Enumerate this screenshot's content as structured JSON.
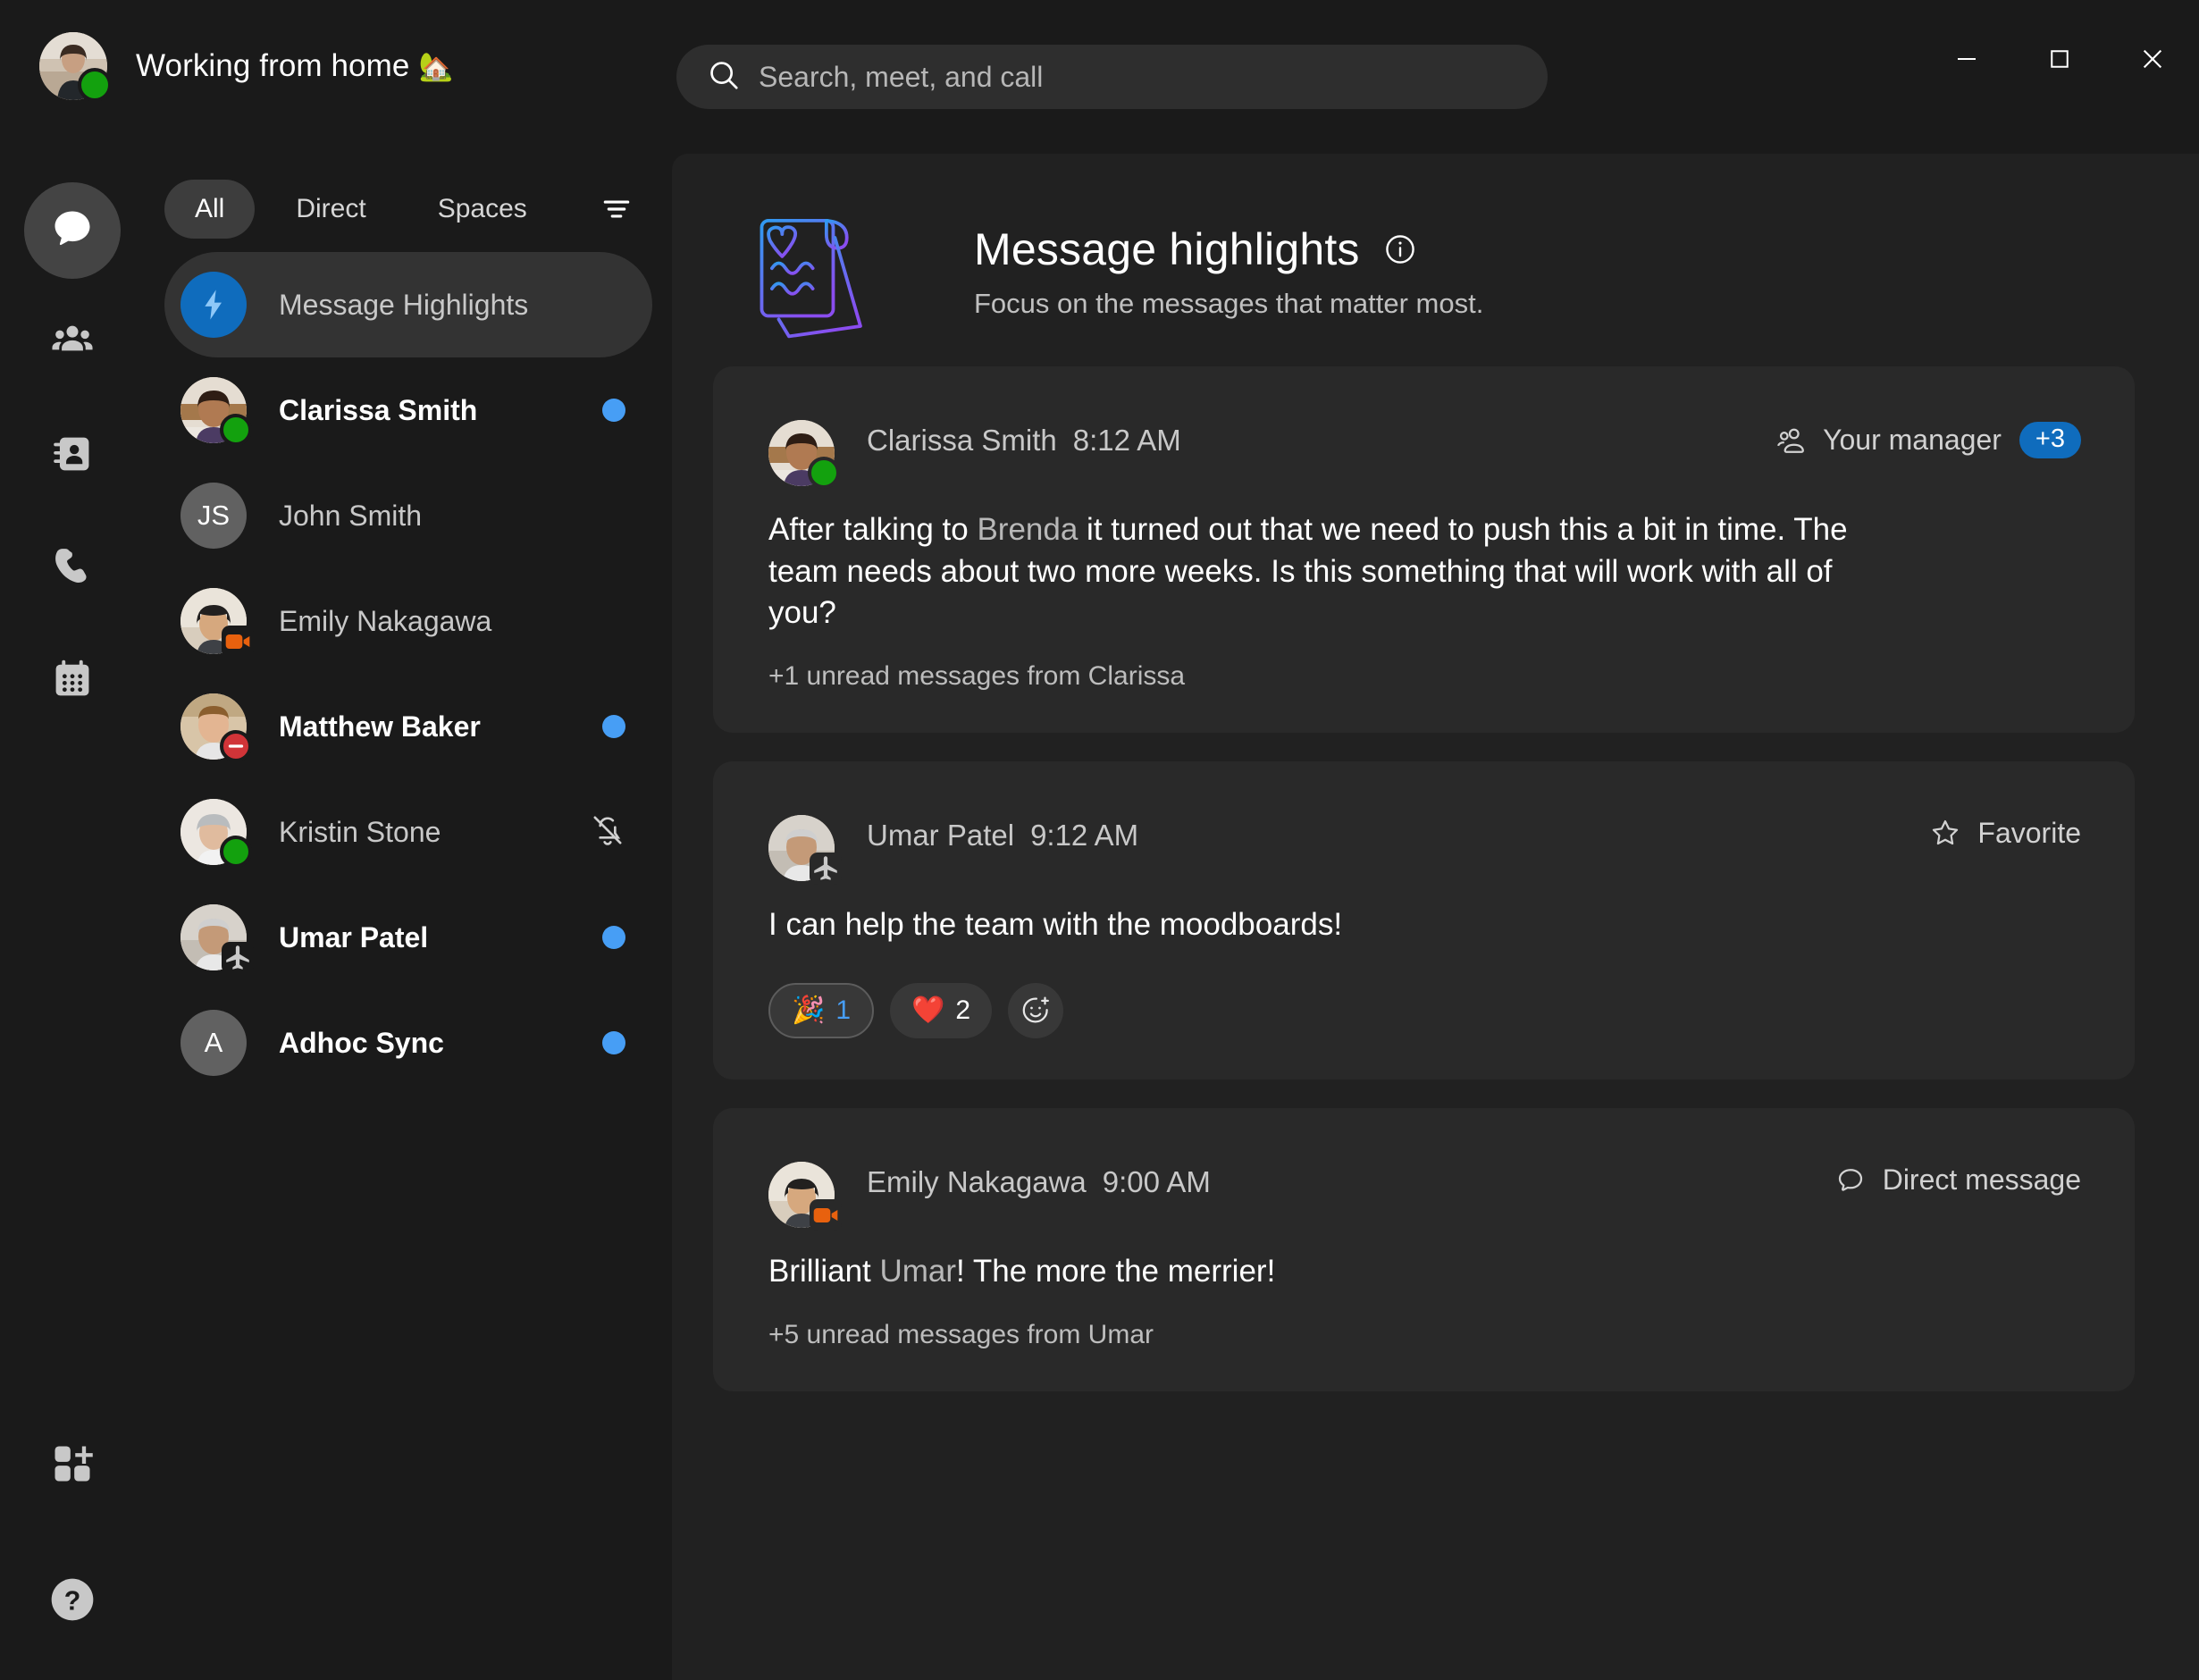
{
  "titlebar": {
    "status_text": "Working from home",
    "status_emoji": "🏡",
    "avatar_presence": "available"
  },
  "search": {
    "placeholder": "Search, meet, and call"
  },
  "window_controls": {
    "minimize": "minimize-icon",
    "maximize": "maximize-icon",
    "close": "close-icon"
  },
  "rail": {
    "items": [
      {
        "icon": "chat-icon",
        "name": "chat",
        "active": true
      },
      {
        "icon": "teams-icon",
        "name": "teams",
        "active": false
      },
      {
        "icon": "contacts-icon",
        "name": "contacts",
        "active": false
      },
      {
        "icon": "calls-icon",
        "name": "calls",
        "active": false
      },
      {
        "icon": "calendar-icon",
        "name": "calendar",
        "active": false
      }
    ],
    "bottom": [
      {
        "icon": "apps-add-icon",
        "name": "apps"
      },
      {
        "icon": "help-icon",
        "name": "help"
      }
    ]
  },
  "chatlist": {
    "filters": [
      {
        "label": "All",
        "active": true
      },
      {
        "label": "Direct",
        "active": false
      },
      {
        "label": "Spaces",
        "active": false
      }
    ],
    "filter_icon": "filter-lines-icon",
    "items": [
      {
        "name": "Message Highlights",
        "type": "highlights",
        "icon": "lightning-icon",
        "selected": true,
        "unread": false,
        "bold": false,
        "presence": "",
        "badge": "",
        "right": ""
      },
      {
        "name": "Clarissa Smith",
        "type": "person",
        "avatar_color": "#c9ac8e",
        "selected": false,
        "unread": true,
        "bold": true,
        "presence": "available",
        "badge": "",
        "right": "unread-dot"
      },
      {
        "name": "John Smith",
        "type": "initials",
        "initials": "JS",
        "selected": false,
        "unread": false,
        "bold": false,
        "presence": "",
        "badge": "",
        "right": ""
      },
      {
        "name": "Emily Nakagawa",
        "type": "person",
        "avatar_color": "#d8c3ab",
        "selected": false,
        "unread": false,
        "bold": false,
        "presence": "",
        "badge": "video",
        "right": ""
      },
      {
        "name": "Matthew Baker",
        "type": "person",
        "avatar_color": "#c7a98b",
        "selected": false,
        "unread": true,
        "bold": true,
        "presence": "busy",
        "badge": "",
        "right": "unread-dot"
      },
      {
        "name": "Kristin Stone",
        "type": "person",
        "avatar_color": "#d5cbc2",
        "selected": false,
        "unread": false,
        "bold": false,
        "presence": "available",
        "badge": "",
        "right": "muted"
      },
      {
        "name": "Umar Patel",
        "type": "person",
        "avatar_color": "#bfb6ad",
        "selected": false,
        "unread": true,
        "bold": true,
        "presence": "",
        "badge": "airplane",
        "right": "unread-dot"
      },
      {
        "name": "Adhoc Sync",
        "type": "initials",
        "initials": "A",
        "selected": false,
        "unread": true,
        "bold": true,
        "presence": "",
        "badge": "",
        "right": "unread-dot"
      }
    ]
  },
  "main": {
    "header": {
      "title": "Message highlights",
      "info_icon": "info-icon",
      "subtitle": "Focus on the messages that matter most.",
      "art": "highlights-illustration"
    },
    "cards": [
      {
        "author": "Clarissa Smith",
        "time": "8:12 AM",
        "tag_icon": "people-icon",
        "tag_label": "Your manager",
        "tag_count": "+3",
        "body_prefix": "After talking to ",
        "mention": "Brenda",
        "body_suffix": " it turned out that we need to push this a bit in time. The team needs about two more weeks. Is this something that will work with all of you?",
        "footer": "+1 unread messages from Clarissa",
        "presence": "available",
        "badge": "",
        "reactions": []
      },
      {
        "author": "Umar Patel",
        "time": "9:12 AM",
        "tag_icon": "star-icon",
        "tag_label": "Favorite",
        "tag_count": "",
        "body_prefix": "I can help the team with the moodboards!",
        "mention": "",
        "body_suffix": "",
        "footer": "",
        "presence": "",
        "badge": "airplane",
        "reactions": [
          {
            "emoji": "🎉",
            "count": "1",
            "mine": true,
            "name": "celebrate-reaction"
          },
          {
            "emoji": "❤️",
            "count": "2",
            "mine": false,
            "name": "heart-reaction"
          }
        ],
        "add_reaction_icon": "add-reaction-icon"
      },
      {
        "author": "Emily Nakagawa",
        "time": "9:00 AM",
        "tag_icon": "chat-bubble-icon",
        "tag_label": "Direct message",
        "tag_count": "",
        "body_prefix": "Brilliant ",
        "mention": "Umar",
        "body_suffix": "! The more the merrier!",
        "footer": "+5 unread messages from Umar",
        "presence": "",
        "badge": "video",
        "reactions": []
      }
    ]
  },
  "colors": {
    "accent": "#0f6cbd",
    "unread_dot": "#479ef5",
    "available": "#13a10e",
    "busy": "#d13438",
    "video_badge": "#e8610e",
    "card_bg": "#292929",
    "main_bg": "#212121",
    "app_bg": "#1a1a1a"
  }
}
